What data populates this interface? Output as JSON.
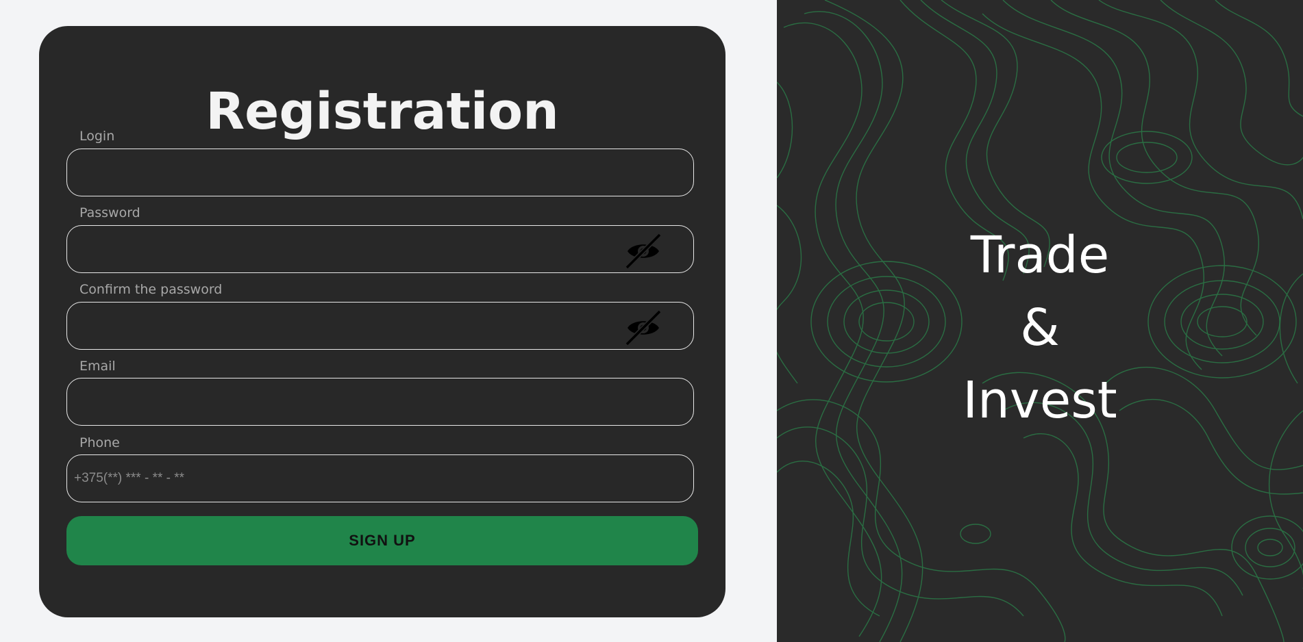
{
  "form": {
    "title": "Registration",
    "fields": {
      "login": {
        "label": "Login",
        "value": "",
        "placeholder": ""
      },
      "password": {
        "label": "Password",
        "value": "",
        "placeholder": ""
      },
      "confirm_password": {
        "label": "Confirm the password",
        "value": "",
        "placeholder": ""
      },
      "email": {
        "label": "Email",
        "value": "",
        "placeholder": ""
      },
      "phone": {
        "label": "Phone",
        "value": "",
        "placeholder": "+375(**) *** - ** - **"
      }
    },
    "submit_label": "SIGN UP",
    "icons": {
      "password_toggle": "eye-off-icon"
    }
  },
  "hero": {
    "lines": [
      "Trade",
      "&",
      "Invest"
    ]
  },
  "colors": {
    "background": "#f3f4f6",
    "card": "#282828",
    "accent": "#20854a",
    "topo_line": "#2a7a48"
  }
}
